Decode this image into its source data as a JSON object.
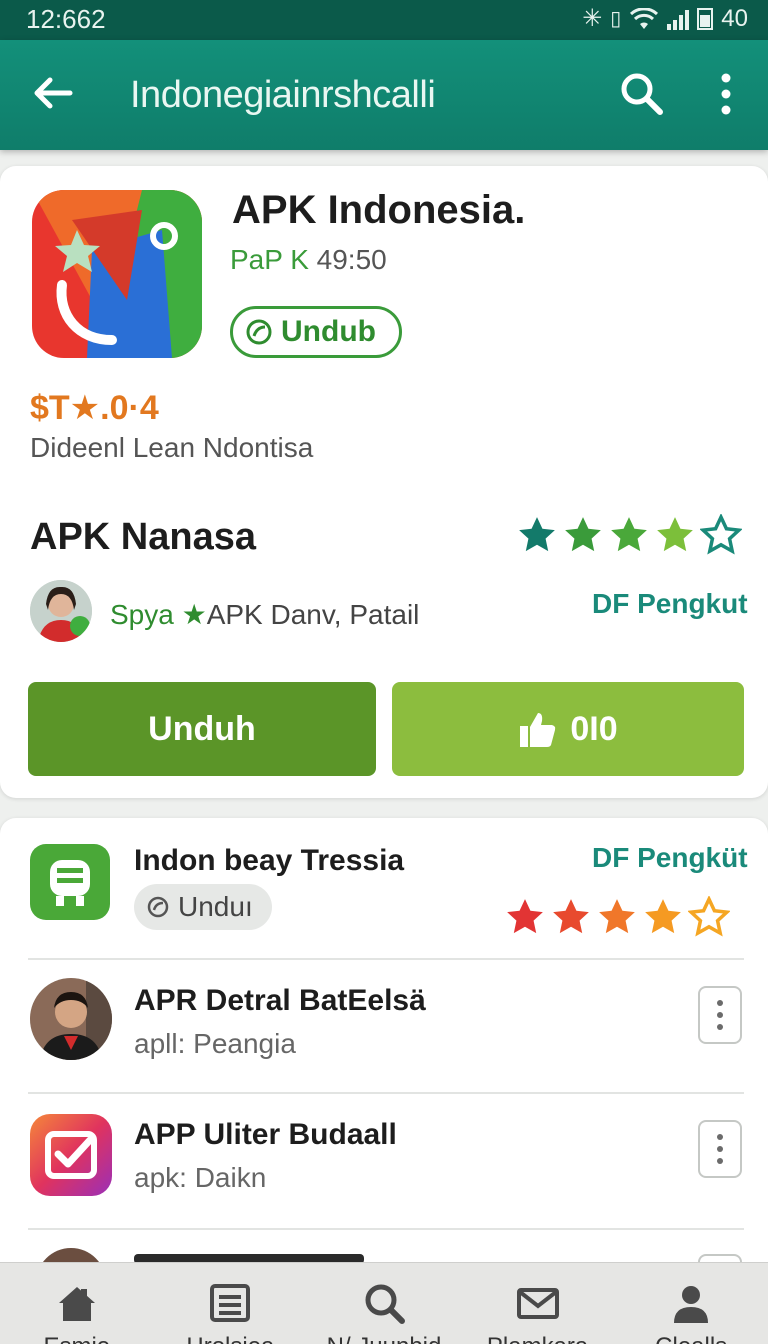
{
  "status_bar": {
    "time": "12:662",
    "right_text": "40",
    "icons": [
      "bluetooth-icon",
      "vibrate-icon",
      "wifi-icon",
      "signal-icon",
      "battery-icon"
    ]
  },
  "app_bar": {
    "title": "Indonegiainrshcalli",
    "icons": [
      "back-arrow-icon",
      "search-icon",
      "more-vert-icon"
    ]
  },
  "featured": {
    "title": "APK Indonesia.",
    "sub_prefix": "PaP K",
    "sub_value": "49:50",
    "download_pill": "Undub",
    "price": "$T★.0·4",
    "description": "Dideenl Lean Ndontisa",
    "name": "APK Nanasa",
    "rating": 4,
    "author_highlight": "Spya ★",
    "author_rest": "APK Danv, Patail",
    "link_label": "DF Pengkut",
    "download_button": "Unduh",
    "like_count": "0I0"
  },
  "list": [
    {
      "title": "Indon beay Tressia",
      "pill": "Unduı",
      "link": "DF Pengküt",
      "rating": 4,
      "icon": "robot-app-icon"
    },
    {
      "title": "APR Detral BatEelsä",
      "subtitle": "apll: Peangia",
      "icon": "person-avatar"
    },
    {
      "title": "APP Uliter Budaall",
      "subtitle": "apk: Daikn",
      "icon": "check-app-icon"
    }
  ],
  "bottom_nav": [
    {
      "label": "Esmie",
      "icon": "home-icon"
    },
    {
      "label": "Hrolsiea",
      "icon": "list-icon"
    },
    {
      "label": "N/ Juunbid",
      "icon": "search-icon"
    },
    {
      "label": "Plamkara",
      "icon": "mail-icon"
    },
    {
      "label": "Clealls",
      "icon": "person-icon"
    }
  ],
  "colors": {
    "app_bar": "#13907a",
    "accent_green": "#5b9528",
    "light_green": "#8cbd3e",
    "teal_link": "#1a8a7a",
    "price_orange": "#e2781f"
  }
}
